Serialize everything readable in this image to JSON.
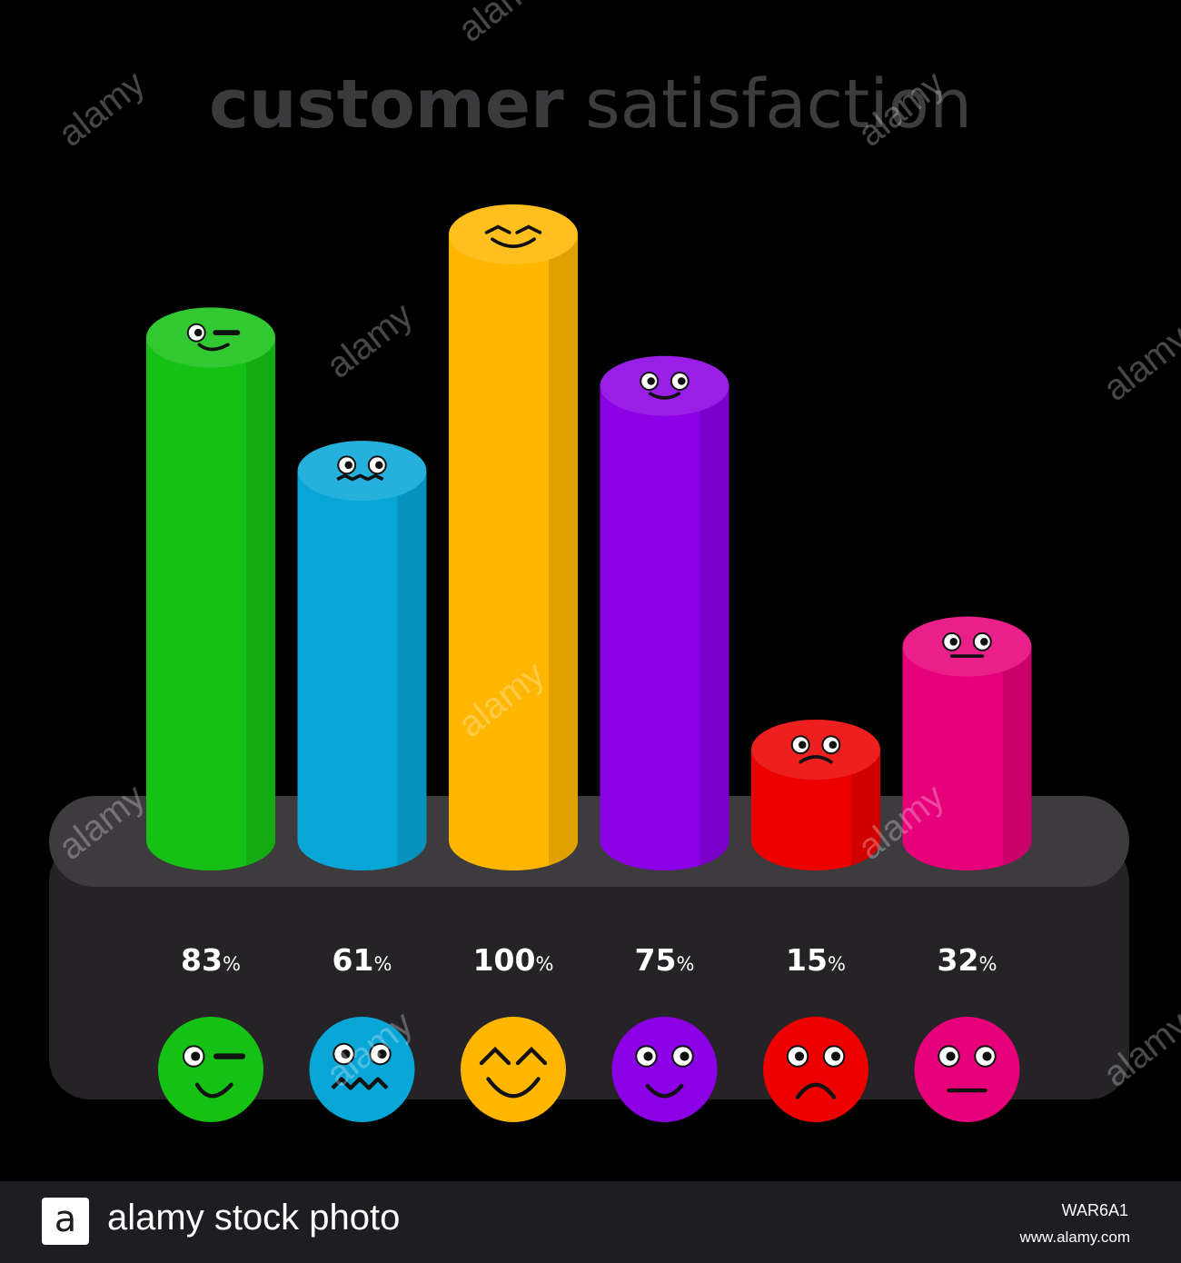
{
  "chart_data": {
    "type": "bar",
    "title_bold": "customer",
    "title_light": "satisfaction",
    "categories": [
      "wink",
      "nervous",
      "happy",
      "smile",
      "sad",
      "neutral"
    ],
    "values": [
      83,
      61,
      100,
      75,
      15,
      32
    ],
    "value_suffix": "%",
    "colors": [
      "#16c116",
      "#07a6d6",
      "#ffb600",
      "#8b00e4",
      "#ec0000",
      "#e6007a"
    ],
    "ylim": [
      0,
      100
    ],
    "grid": false,
    "legend": "none"
  },
  "watermark": "alamy",
  "footer": {
    "logo_letter": "a",
    "brand": "alamy stock photo",
    "code": "WAR6A1",
    "site": "www.alamy.com"
  }
}
